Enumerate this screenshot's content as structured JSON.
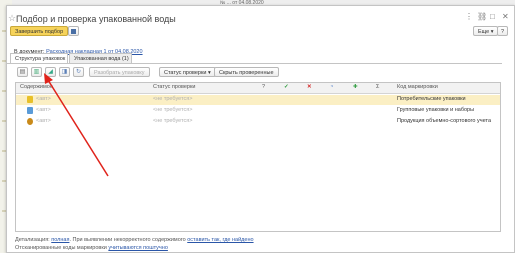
{
  "background": {
    "window_caption": "№ ... от 04.08.2020"
  },
  "window": {
    "title": "Подбор и проверка упакованной воды",
    "controls": {
      "more": "⋮",
      "link": "⛓",
      "maximize": "□",
      "close": "✕"
    }
  },
  "toolbar": {
    "finish_label": "Завершить подбор",
    "save_icon": "save-icon",
    "more_label": "Еще ▾",
    "help_label": "?"
  },
  "document": {
    "prefix": "В документ:",
    "link_text": "Расходная накладная 1 от 04.08.2020"
  },
  "tabs": [
    {
      "label": "Структура упаковок",
      "active": true
    },
    {
      "label": "Упакованная вода (1)",
      "active": false
    }
  ],
  "actions": {
    "unpack_label": "Разобрать упаковку",
    "status_label": "Статус проверки ▾",
    "hide_checked_label": "Скрыть проверенные"
  },
  "table": {
    "headers": {
      "content": "Содержимое",
      "status": "Статус проверки",
      "question": "?",
      "check": "✓",
      "cross": "✕",
      "circle": "◔",
      "plus": "✚",
      "sum": "Σ",
      "code": "Код маркировки"
    },
    "rows": [
      {
        "content": "<авт>",
        "status": "<не требуется>",
        "code": "Потребительские упаковки",
        "selected": true,
        "icon_color": "#e8c028"
      },
      {
        "content": "<авт>",
        "status": "<не требуется>",
        "code": "Групповые упаковки и наборы",
        "selected": false,
        "icon_color": "#5a9bd8"
      },
      {
        "content": "<авт>",
        "status": "<не требуется>",
        "code": "Продукция объемно-сортового учета",
        "selected": false,
        "icon_color": "#c98a1a"
      }
    ]
  },
  "footer": {
    "detail_prefix": "Детализация:",
    "detail_link": "полная",
    "detail_mid": ". При выявлении некорректного содержимого",
    "detail_link2": "оставить так, где найдено",
    "codes_prefix": "Отсканированные коды маркировки",
    "codes_link": "учитываются поштучно"
  },
  "colors": {
    "accent": "#f6d35a",
    "selection": "#fbefc4",
    "link": "#2a56a8",
    "annotation_arrow": "#e0231b"
  }
}
